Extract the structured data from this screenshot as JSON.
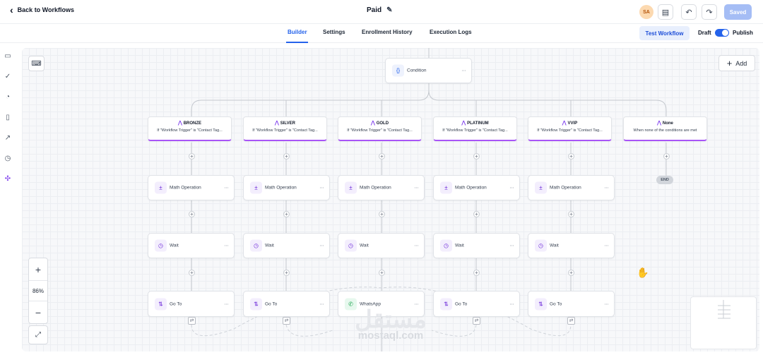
{
  "header": {
    "back_label": "Back to Workflows",
    "title": "Paid",
    "avatar_initials": "SA",
    "saved_label": "Saved"
  },
  "tabs": [
    {
      "label": "Builder",
      "active": true
    },
    {
      "label": "Settings",
      "active": false
    },
    {
      "label": "Enrollment History",
      "active": false
    },
    {
      "label": "Execution Logs",
      "active": false
    }
  ],
  "actions": {
    "test_label": "Test Workflow",
    "draft_label": "Draft",
    "publish_label": "Publish",
    "publish_on": true
  },
  "canvas": {
    "add_label": "Add",
    "zoom_level": "86%",
    "zoom_in": "+",
    "zoom_out": "−",
    "condition_label": "Condition",
    "end_label": "END",
    "branches": [
      {
        "name": "BRONZE",
        "subtitle": "If \"Workflow Trigger\" is \"Contact Tag...",
        "math": "Math Operation",
        "wait": "Wait",
        "last": "Go To"
      },
      {
        "name": "SILVER",
        "subtitle": "If \"Workflow Trigger\" is \"Contact Tag...",
        "math": "Math Operation",
        "wait": "Wait",
        "last": "Go To"
      },
      {
        "name": "GOLD",
        "subtitle": "If \"Workflow Trigger\" is \"Contact Tag...",
        "math": "Math Operation",
        "wait": "Wait",
        "last": "WhatsApp"
      },
      {
        "name": "PLATINUM",
        "subtitle": "If \"Workflow Trigger\" is \"Contact Tag...",
        "math": "Math Operation",
        "wait": "Wait",
        "last": "Go To"
      },
      {
        "name": "VVIP",
        "subtitle": "If \"Workflow Trigger\" is \"Contact Tag...",
        "math": "Math Operation",
        "wait": "Wait",
        "last": "Go To"
      },
      {
        "name": "None",
        "subtitle": "When none of the conditions are met"
      }
    ]
  },
  "watermark": {
    "arabic": "مستقل",
    "latin": "mostaql.com"
  },
  "colors": {
    "accent": "#2563eb",
    "branch_border": "#a855f7",
    "icon_purple": "#6d28d9"
  }
}
